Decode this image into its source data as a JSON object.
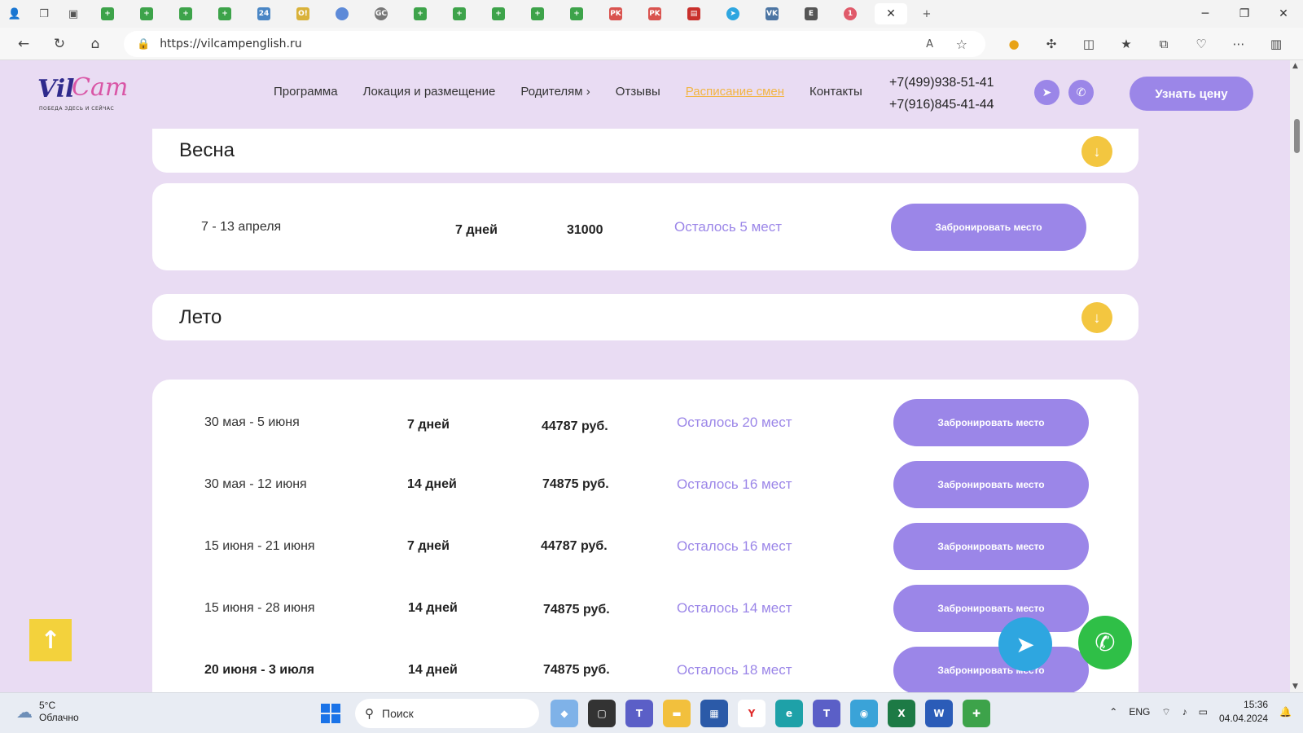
{
  "browser": {
    "url": "https://vilcampenglish.ru",
    "tab_badge_24": "24",
    "tab_badge_o": "O!",
    "tab_badge_gc": "GC",
    "tab_badge_pk": "PK",
    "tab_badge_vk": "VK",
    "tab_badge_1": "1"
  },
  "logo": {
    "part1": "Vil",
    "part2": "Cam",
    "tagline": "ПОБЕДА ЗДЕСЬ И СЕЙЧАС"
  },
  "nav": {
    "items": [
      "Программа",
      "Локация и размещение",
      "Родителям ›",
      "Отзывы",
      "Расписание смен",
      "Контакты"
    ],
    "active_index": 4
  },
  "phones": [
    "+7(499)938-51-41",
    "+7(916)845-41-44"
  ],
  "cta_label": "Узнать цену",
  "book_label": "Забронировать место",
  "spring": {
    "title": "Весна",
    "rows": [
      {
        "dates": "7 - 13 апреля",
        "days": "7 дней",
        "price": "31000",
        "left": "Осталось 5 мест"
      }
    ]
  },
  "summer": {
    "title": "Лето",
    "rows": [
      {
        "dates": "30 мая - 5 июня",
        "days": "7 дней",
        "price": "44787 руб.",
        "left": "Осталось 20 мест"
      },
      {
        "dates": "30 мая - 12 июня",
        "days": "14 дней",
        "price": "74875 руб.",
        "left": "Осталось 16 мест"
      },
      {
        "dates": "15 июня - 21 июня",
        "days": "7 дней",
        "price": "44787 руб.",
        "left": "Осталось 16 мест"
      },
      {
        "dates": "15 июня - 28 июня",
        "days": "14 дней",
        "price": "74875 руб.",
        "left": "Осталось 14 мест"
      },
      {
        "dates": "20 июня - 3 июля",
        "days": "14 дней",
        "price": "74875 руб.",
        "left": "Осталось 18 мест"
      }
    ]
  },
  "taskbar": {
    "weather_temp": "5°C",
    "weather_desc": "Облачно",
    "search_placeholder": "Поиск",
    "lang": "ENG",
    "time": "15:36",
    "date": "04.04.2024"
  },
  "colors": {
    "accent": "#9b86e8",
    "background": "#e9dcf3",
    "yellow": "#f3c640",
    "active_nav": "#f2b544"
  }
}
